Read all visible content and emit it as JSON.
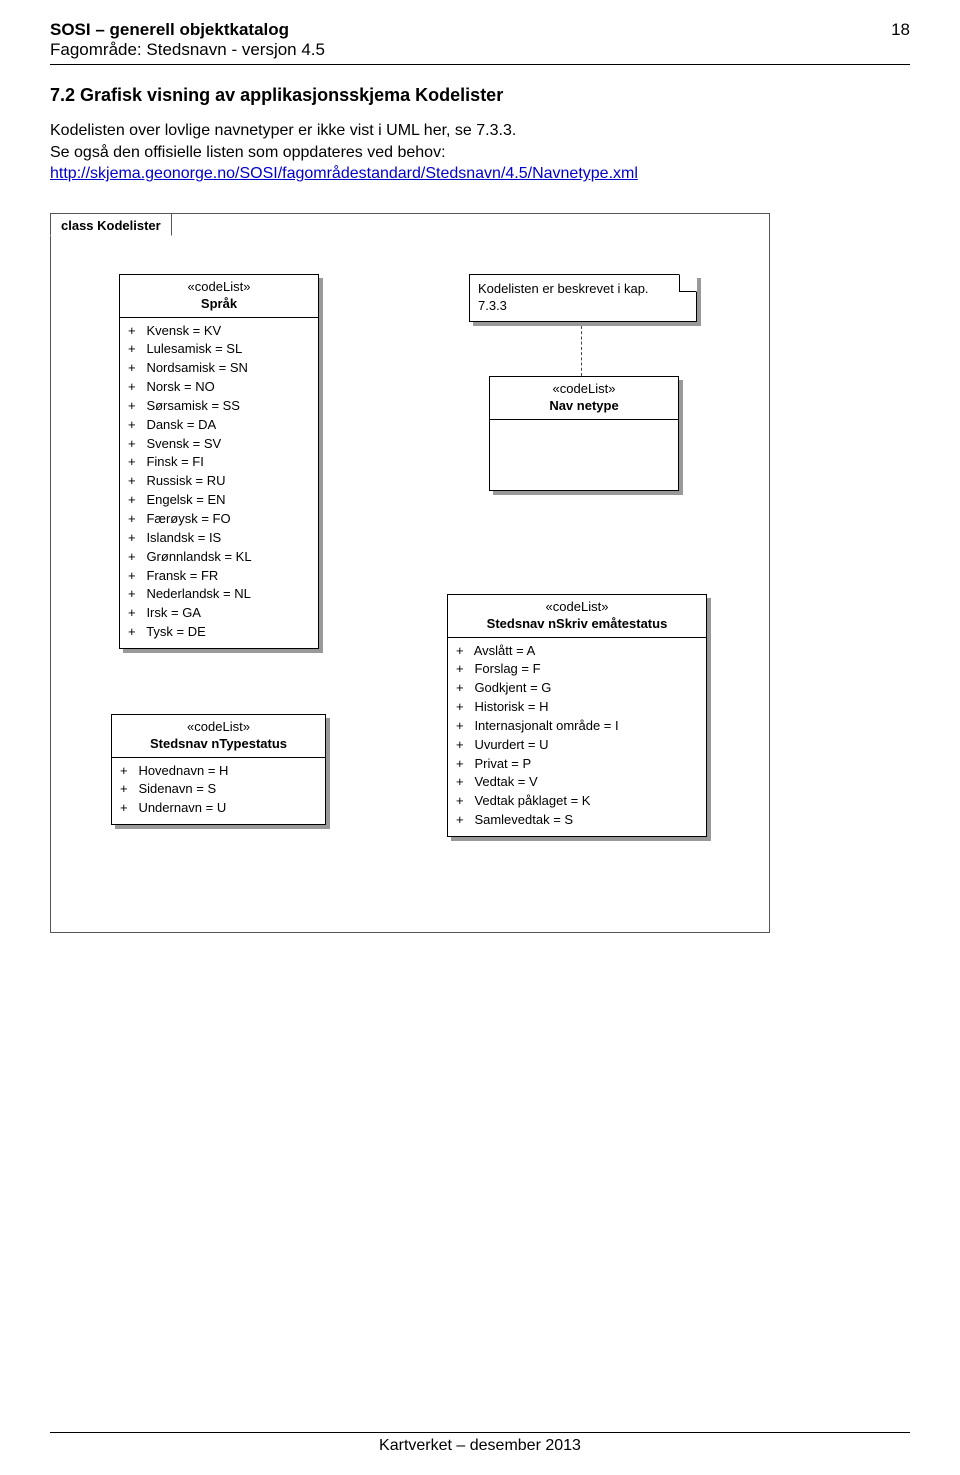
{
  "header": {
    "title": "SOSI – generell objektkatalog",
    "subtitle": "Fagområde: Stedsnavn - versjon 4.5",
    "page_number": "18"
  },
  "section": {
    "heading": "7.2 Grafisk visning av applikasjonsskjema Kodelister",
    "line1": "Kodelisten over lovlige navnetyper er ikke vist i UML her, se 7.3.3.",
    "line2": "Se også den offisielle listen som oppdateres ved behov:",
    "link_text": "http://skjema.geonorge.no/SOSI/fagområdestandard/Stedsnavn/4.5/Navnetype.xml"
  },
  "diagram": {
    "tab": "class Kodelister",
    "note": {
      "l1": "Kodelisten er  beskrevet i kap.",
      "l2": "7.3.3"
    },
    "sprak": {
      "stereo": "«codeList»",
      "name": "Språk",
      "attrs": [
        "Kvensk = KV",
        "Lulesamisk = SL",
        "Nordsamisk = SN",
        "Norsk = NO",
        "Sørsamisk = SS",
        "Dansk = DA",
        "Svensk = SV",
        "Finsk = FI",
        "Russisk = RU",
        "Engelsk = EN",
        "Færøysk = FO",
        "Islandsk = IS",
        "Grønnlandsk = KL",
        "Fransk = FR",
        "Nederlandsk = NL",
        "Irsk = GA",
        "Tysk = DE"
      ]
    },
    "navnetype": {
      "stereo": "«codeList»",
      "name": "Nav netype"
    },
    "typestatus": {
      "stereo": "«codeList»",
      "name": "Stedsnav nTypestatus",
      "attrs": [
        "Hovednavn = H",
        "Sidenavn = S",
        "Undernavn = U"
      ]
    },
    "skrivemate": {
      "stereo": "«codeList»",
      "name": "Stedsnav nSkriv emåtestatus",
      "attrs": [
        "Avslått = A",
        "Forslag = F",
        "Godkjent = G",
        "Historisk = H",
        "Internasjonalt område = I",
        "Uvurdert = U",
        "Privat = P",
        "Vedtak = V",
        "Vedtak påklaget = K",
        "Samlevedtak = S"
      ]
    }
  },
  "footer": {
    "text": "Kartverket – desember 2013"
  }
}
